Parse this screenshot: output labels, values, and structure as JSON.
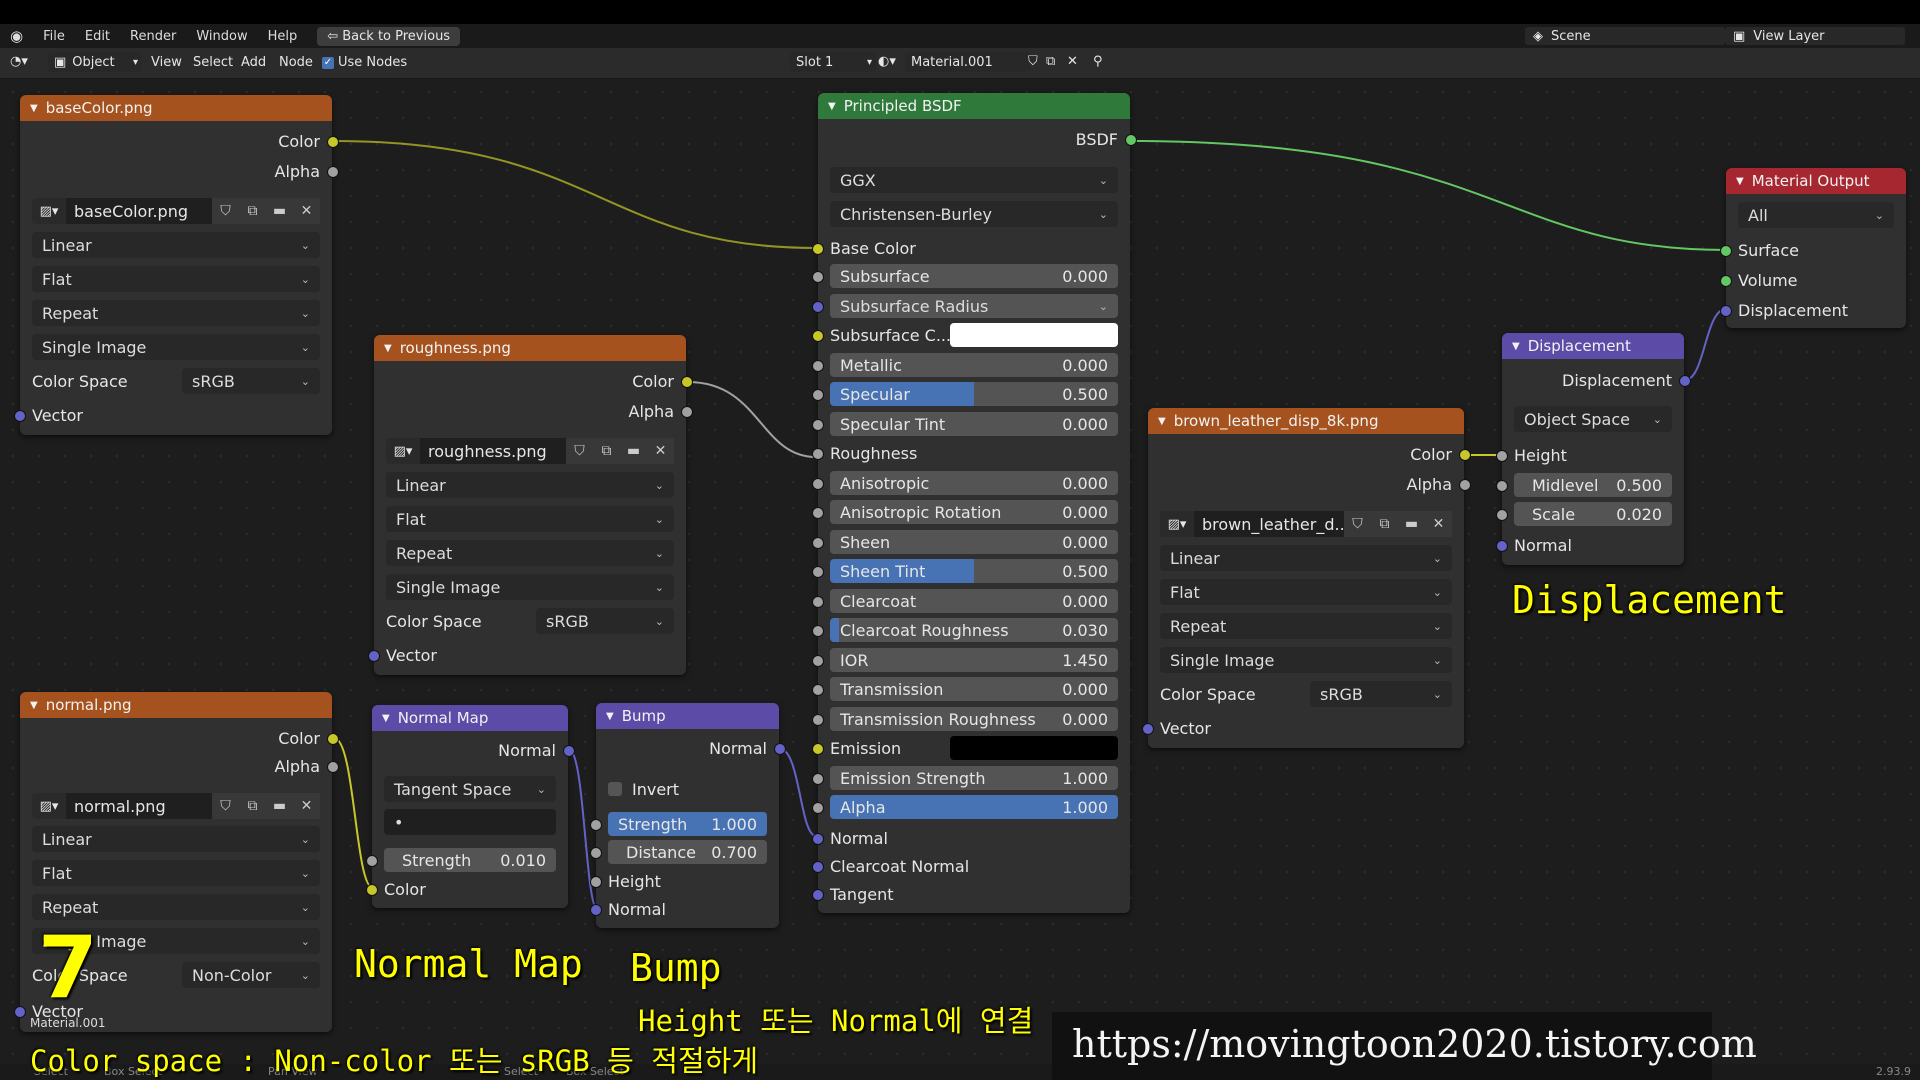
{
  "menubar": {
    "items": [
      "File",
      "Edit",
      "Render",
      "Window",
      "Help"
    ],
    "back_button": "Back to Previous",
    "scene": "Scene",
    "view_layer": "View Layer"
  },
  "header": {
    "mode": "Object",
    "items": [
      "View",
      "Select",
      "Add",
      "Node"
    ],
    "use_nodes": "Use Nodes",
    "slot": "Slot 1",
    "material": "Material.001"
  },
  "nodes": {
    "basecolor": {
      "title": "baseColor.png",
      "out_color": "Color",
      "out_alpha": "Alpha",
      "image": "baseColor.png",
      "interp": "Linear",
      "proj": "Flat",
      "ext": "Repeat",
      "source": "Single Image",
      "cs_label": "Color Space",
      "cs_value": "sRGB",
      "vector": "Vector"
    },
    "roughness": {
      "title": "roughness.png",
      "out_color": "Color",
      "out_alpha": "Alpha",
      "image": "roughness.png",
      "interp": "Linear",
      "proj": "Flat",
      "ext": "Repeat",
      "source": "Single Image",
      "cs_label": "Color Space",
      "cs_value": "sRGB",
      "vector": "Vector"
    },
    "normal": {
      "title": "normal.png",
      "out_color": "Color",
      "out_alpha": "Alpha",
      "image": "normal.png",
      "interp": "Linear",
      "proj": "Flat",
      "ext": "Repeat",
      "source": "Single Image",
      "cs_label": "Color Space",
      "cs_value": "Non-Color",
      "vector": "Vector"
    },
    "disp_tex": {
      "title": "brown_leather_disp_8k.png",
      "out_color": "Color",
      "out_alpha": "Alpha",
      "image": "brown_leather_d...",
      "interp": "Linear",
      "proj": "Flat",
      "ext": "Repeat",
      "source": "Single Image",
      "cs_label": "Color Space",
      "cs_value": "sRGB",
      "vector": "Vector"
    },
    "normalmap": {
      "title": "Normal Map",
      "out_normal": "Normal",
      "space": "Tangent Space",
      "uv": "•",
      "strength_label": "Strength",
      "strength": "0.010",
      "in_color": "Color"
    },
    "bump": {
      "title": "Bump",
      "out_normal": "Normal",
      "invert": "Invert",
      "strength_label": "Strength",
      "strength": "1.000",
      "distance_label": "Distance",
      "distance": "0.700",
      "in_height": "Height",
      "in_normal": "Normal"
    },
    "bsdf": {
      "title": "Principled BSDF",
      "out": "BSDF",
      "dist": "GGX",
      "sss_method": "Christensen-Burley",
      "base_color": "Base Color",
      "fields": [
        {
          "label": "Subsurface",
          "value": "0.000",
          "fill": 0
        },
        {
          "label": "Subsurface Radius",
          "value": "",
          "fill": 0
        },
        {
          "label": "Subsurface C...",
          "value": "",
          "fill": 0
        },
        {
          "label": "Metallic",
          "value": "0.000",
          "fill": 0
        },
        {
          "label": "Specular",
          "value": "0.500",
          "fill": 0.5
        },
        {
          "label": "Specular Tint",
          "value": "0.000",
          "fill": 0
        },
        {
          "label": "Roughness",
          "value": "",
          "fill": 0
        },
        {
          "label": "Anisotropic",
          "value": "0.000",
          "fill": 0
        },
        {
          "label": "Anisotropic Rotation",
          "value": "0.000",
          "fill": 0
        },
        {
          "label": "Sheen",
          "value": "0.000",
          "fill": 0
        },
        {
          "label": "Sheen Tint",
          "value": "0.500",
          "fill": 0.5
        },
        {
          "label": "Clearcoat",
          "value": "0.000",
          "fill": 0
        },
        {
          "label": "Clearcoat Roughness",
          "value": "0.030",
          "fill": 0.03
        },
        {
          "label": "IOR",
          "value": "1.450",
          "fill": 0
        },
        {
          "label": "Transmission",
          "value": "0.000",
          "fill": 0
        },
        {
          "label": "Transmission Roughness",
          "value": "0.000",
          "fill": 0
        },
        {
          "label": "Emission",
          "value": "",
          "fill": 0
        },
        {
          "label": "Emission Strength",
          "value": "1.000",
          "fill": 0
        },
        {
          "label": "Alpha",
          "value": "1.000",
          "fill": 1
        }
      ],
      "normal": "Normal",
      "clearcoat_normal": "Clearcoat Normal",
      "tangent": "Tangent"
    },
    "displacement": {
      "title": "Displacement",
      "out": "Displacement",
      "space": "Object Space",
      "height": "Height",
      "midlevel_label": "Midlevel",
      "midlevel": "0.500",
      "scale_label": "Scale",
      "scale": "0.020",
      "normal": "Normal"
    },
    "output": {
      "title": "Material Output",
      "target": "All",
      "surface": "Surface",
      "volume": "Volume",
      "displacement": "Displacement"
    }
  },
  "annotations": {
    "number": "7",
    "material_small": "Material.001",
    "normal_map": "Normal Map",
    "bump": "Bump",
    "displacement": "Displacement",
    "height_normal": "Height 또는 Normal에 연결",
    "color_space": "Color space : Non-color 또는 sRGB 등 적절하게",
    "url": "https://movingtoon2020.tistory.com",
    "version": "2.93.9"
  },
  "statusbar": {
    "items": [
      "Select",
      "Box Select",
      "Pan View",
      "Select",
      "Box Select"
    ]
  }
}
